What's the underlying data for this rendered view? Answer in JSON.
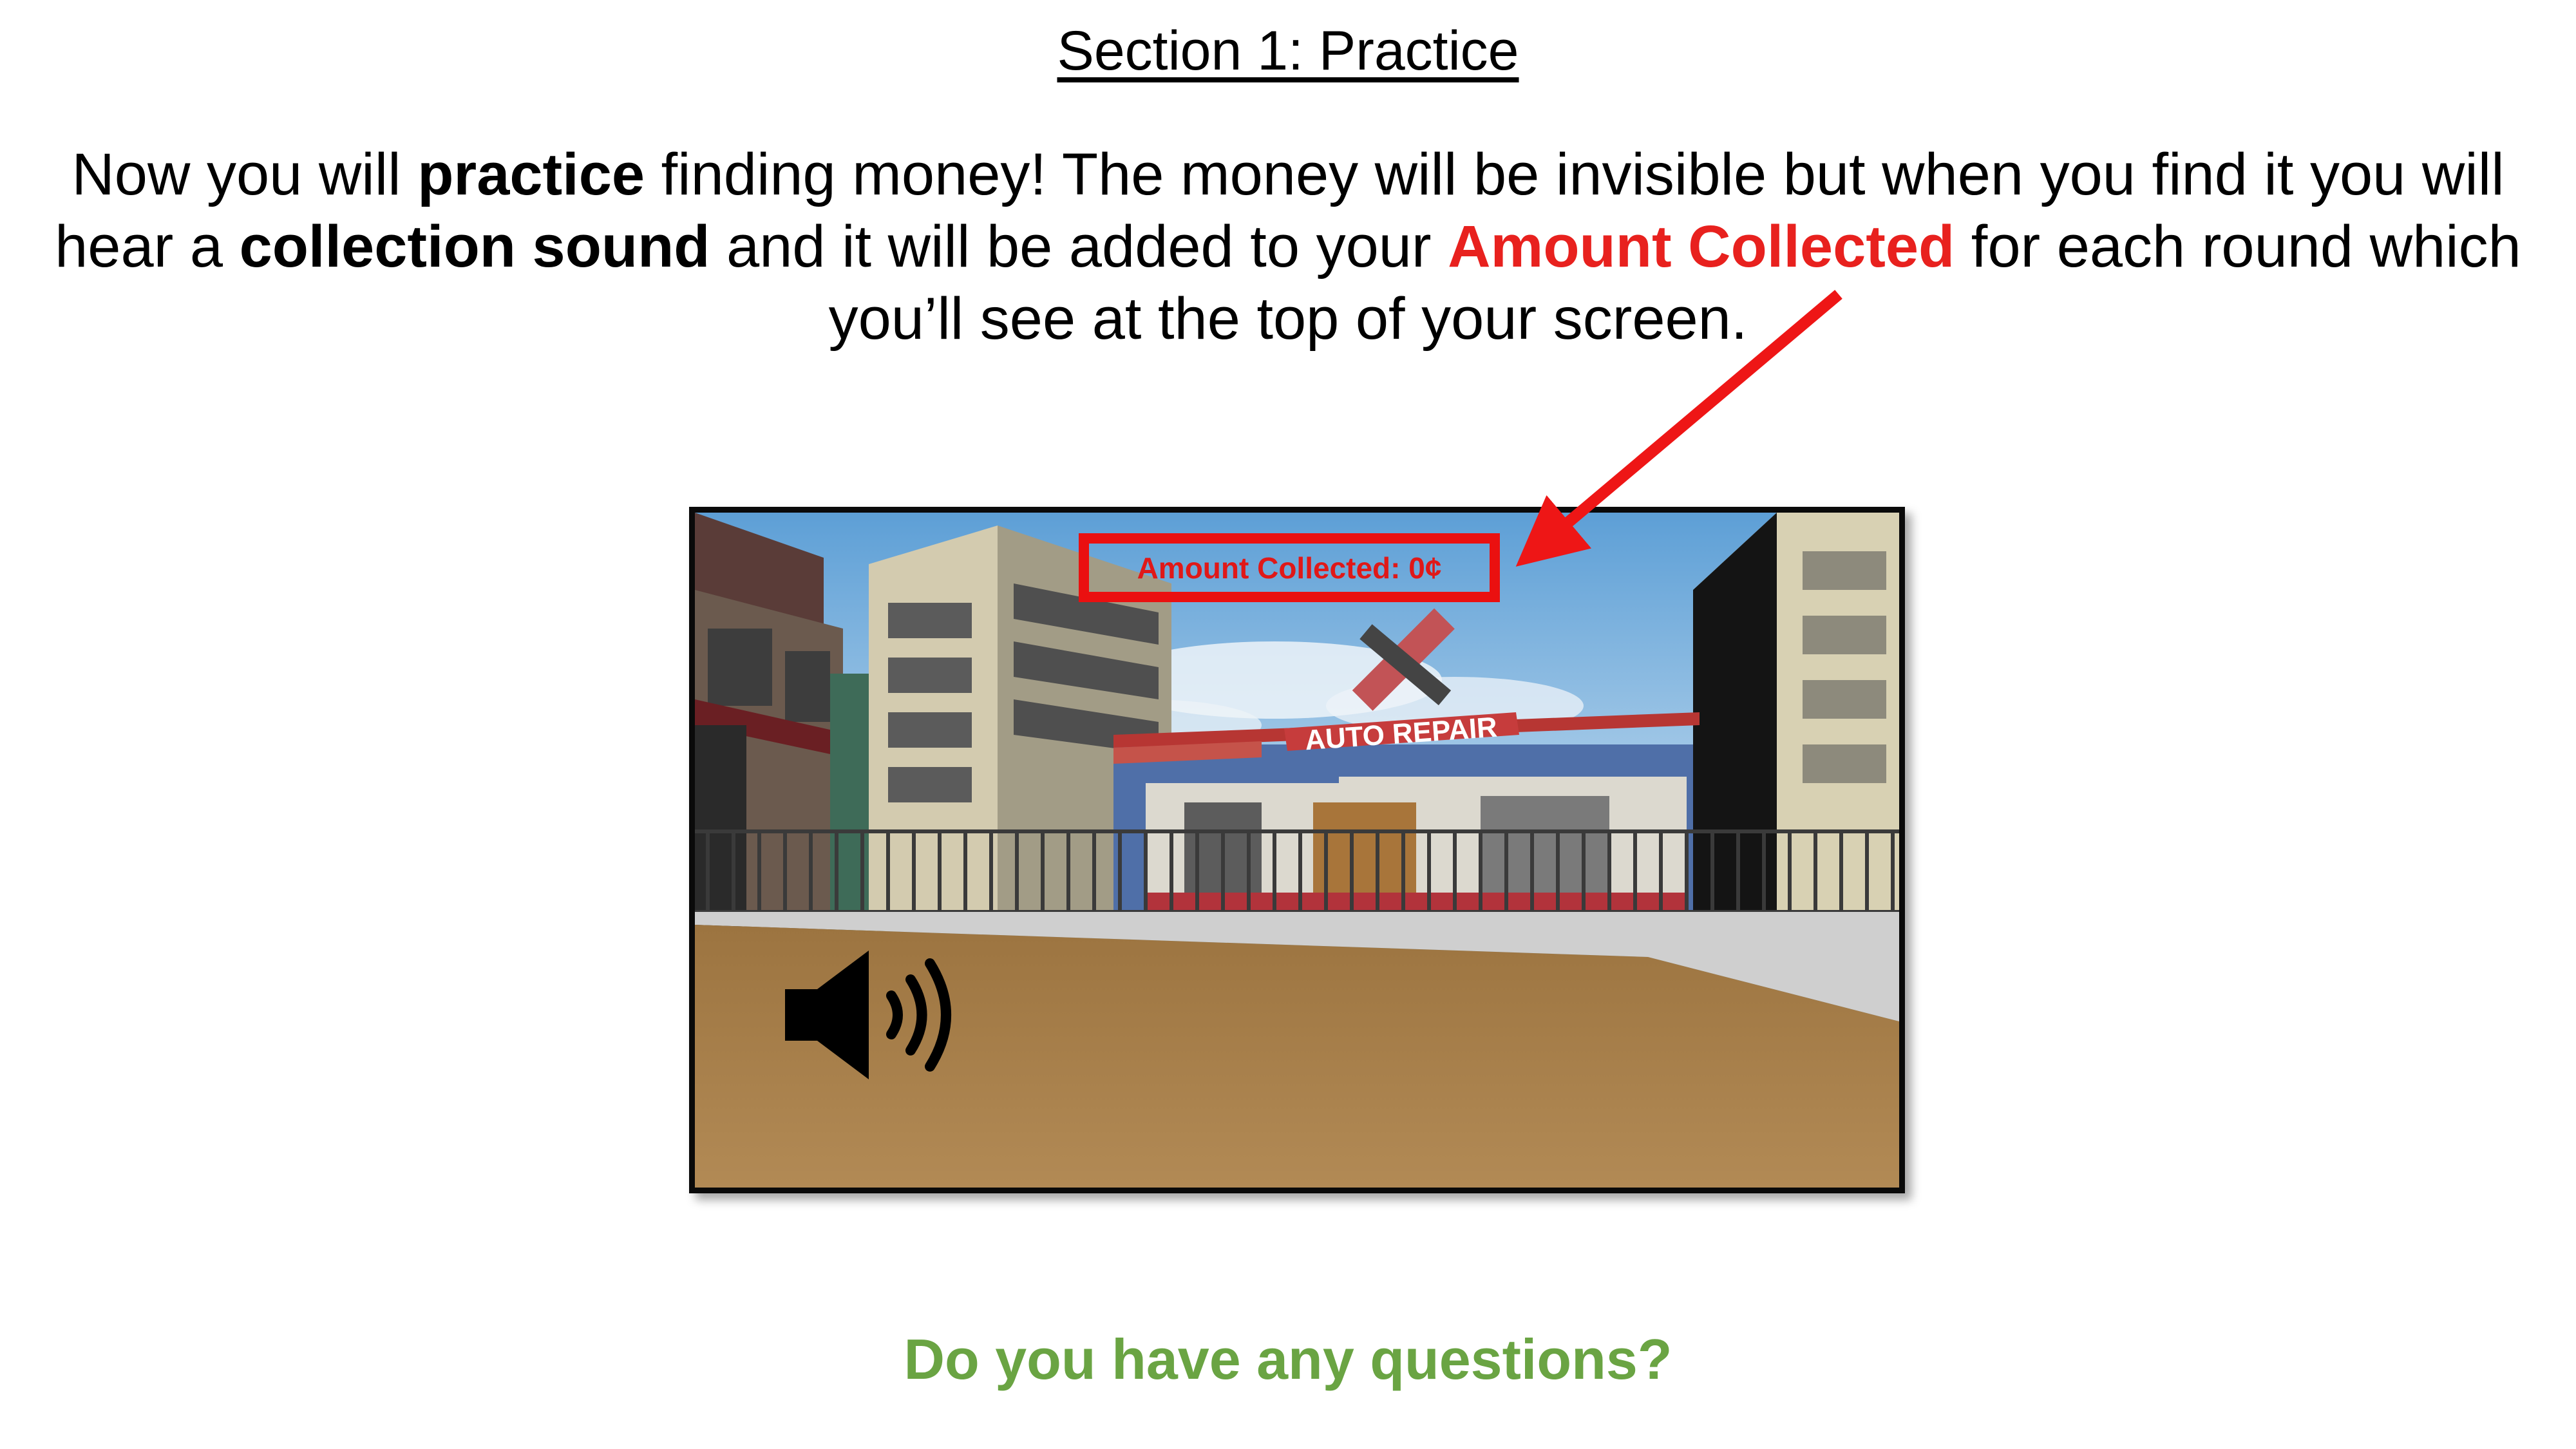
{
  "slide": {
    "title": "Section 1: Practice",
    "instructions": {
      "t1": "Now you will ",
      "b1": "practice",
      "t2": " finding money! The money will be invisible but when you find it you will hear a ",
      "b2": "collection sound",
      "t3": " and it will be added to your ",
      "highlight": "Amount Collected",
      "t4": " for each round which you’ll see at the top of your screen."
    },
    "question": "Do you have any questions?"
  },
  "game": {
    "hud_label": "Amount Collected: 0¢",
    "sign_text": "AUTO REPAIR"
  },
  "icons": [
    "speaker-sound-icon",
    "arrow-pointer"
  ],
  "colors": {
    "highlight": "#e8211e",
    "question": "#6aa443",
    "hud_border": "#ea1010"
  }
}
